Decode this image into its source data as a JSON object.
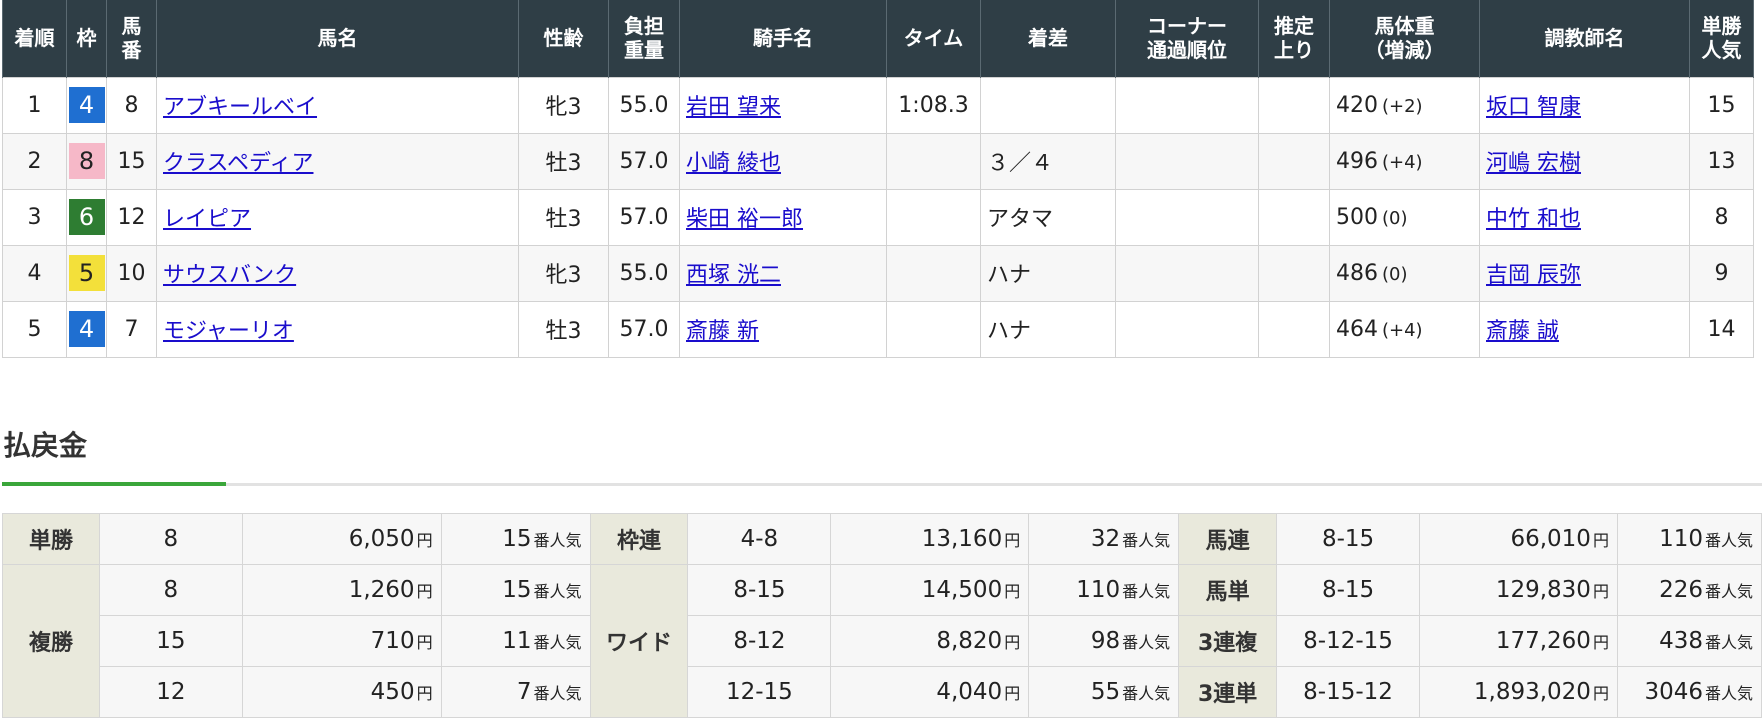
{
  "results": {
    "headers": [
      {
        "l1": "着順",
        "l2": ""
      },
      {
        "l1": "枠",
        "l2": ""
      },
      {
        "l1": "馬",
        "l2": "番"
      },
      {
        "l1": "馬名",
        "l2": ""
      },
      {
        "l1": "性齢",
        "l2": ""
      },
      {
        "l1": "負担",
        "l2": "重量"
      },
      {
        "l1": "騎手名",
        "l2": ""
      },
      {
        "l1": "タイム",
        "l2": ""
      },
      {
        "l1": "着差",
        "l2": ""
      },
      {
        "l1": "コーナー",
        "l2": "通過順位"
      },
      {
        "l1": "推定",
        "l2": "上り"
      },
      {
        "l1": "馬体重",
        "l2": "（増減）"
      },
      {
        "l1": "調教師名",
        "l2": ""
      },
      {
        "l1": "単勝",
        "l2": "人気"
      }
    ],
    "rows": [
      {
        "rank": "1",
        "waku": "4",
        "umaban": "8",
        "horse": "アブキールベイ",
        "sexage": "牝3",
        "weight": "55.0",
        "jockey": "岩田 望来",
        "time": "1:08.3",
        "margin": "",
        "corner": "",
        "last": "",
        "body": "420",
        "diff": "(+2)",
        "trainer": "坂口 智康",
        "pop": "15"
      },
      {
        "rank": "2",
        "waku": "8",
        "umaban": "15",
        "horse": "クラスペディア",
        "sexage": "牡3",
        "weight": "57.0",
        "jockey": "小崎 綾也",
        "time": "",
        "margin": "３／４",
        "corner": "",
        "last": "",
        "body": "496",
        "diff": "(+4)",
        "trainer": "河嶋 宏樹",
        "pop": "13"
      },
      {
        "rank": "3",
        "waku": "6",
        "umaban": "12",
        "horse": "レイピア",
        "sexage": "牡3",
        "weight": "57.0",
        "jockey": "柴田 裕一郎",
        "time": "",
        "margin": "アタマ",
        "corner": "",
        "last": "",
        "body": "500",
        "diff": "(0)",
        "trainer": "中竹 和也",
        "pop": "8"
      },
      {
        "rank": "4",
        "waku": "5",
        "umaban": "10",
        "horse": "サウスバンク",
        "sexage": "牝3",
        "weight": "55.0",
        "jockey": "西塚 洸二",
        "time": "",
        "margin": "ハナ",
        "corner": "",
        "last": "",
        "body": "486",
        "diff": "(0)",
        "trainer": "吉岡 辰弥",
        "pop": "9"
      },
      {
        "rank": "5",
        "waku": "4",
        "umaban": "7",
        "horse": "モジャーリオ",
        "sexage": "牡3",
        "weight": "57.0",
        "jockey": "斎藤 新",
        "time": "",
        "margin": "ハナ",
        "corner": "",
        "last": "",
        "body": "464",
        "diff": "(+4)",
        "trainer": "斎藤 誠",
        "pop": "14"
      }
    ],
    "waku_colors": {
      "4": {
        "bg": "#1f6fd1",
        "fg": "#ffffff"
      },
      "5": {
        "bg": "#f3e03a",
        "fg": "#222222"
      },
      "6": {
        "bg": "#2e7d32",
        "fg": "#ffffff"
      },
      "8": {
        "bg": "#f6b8c8",
        "fg": "#222222"
      }
    }
  },
  "payout": {
    "title": "払戻金",
    "accent_color": "#3aa63a",
    "yen": "円",
    "ninki": "番人気",
    "labels": {
      "tansho": "単勝",
      "fukusho": "複勝",
      "wakuren": "枠連",
      "wide": "ワイド",
      "umaren": "馬連",
      "umatan": "馬単",
      "sanrenpuku": "3連複",
      "sanrentan": "3連単"
    },
    "rows": [
      {
        "left": {
          "combo": "8",
          "amount": "6,050",
          "pop": "15"
        },
        "mid": {
          "combo": "4-8",
          "amount": "13,160",
          "pop": "32"
        },
        "right": {
          "combo": "8-15",
          "amount": "66,010",
          "pop": "110"
        }
      },
      {
        "left": {
          "combo": "8",
          "amount": "1,260",
          "pop": "15"
        },
        "mid": {
          "combo": "8-15",
          "amount": "14,500",
          "pop": "110"
        },
        "right": {
          "combo": "8-15",
          "amount": "129,830",
          "pop": "226"
        }
      },
      {
        "left": {
          "combo": "15",
          "amount": "710",
          "pop": "11"
        },
        "mid": {
          "combo": "8-12",
          "amount": "8,820",
          "pop": "98"
        },
        "right": {
          "combo": "8-12-15",
          "amount": "177,260",
          "pop": "438"
        }
      },
      {
        "left": {
          "combo": "12",
          "amount": "450",
          "pop": "7"
        },
        "mid": {
          "combo": "12-15",
          "amount": "4,040",
          "pop": "55"
        },
        "right": {
          "combo": "8-15-12",
          "amount": "1,893,020",
          "pop": "3046"
        }
      }
    ]
  }
}
